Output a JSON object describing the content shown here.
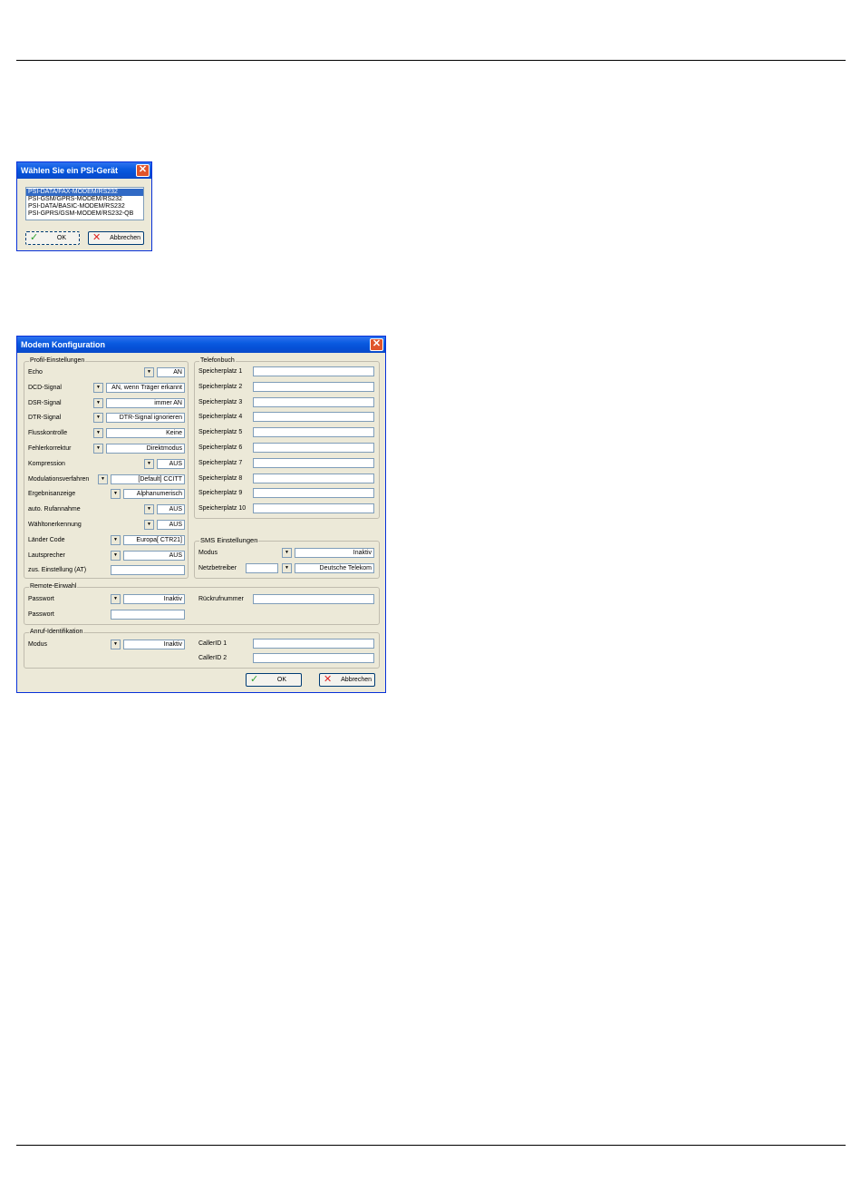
{
  "select_dialog": {
    "title": "Wählen Sie ein PSI-Gerät",
    "devices": [
      "PSI-DATA/FAX-MODEM/RS232",
      "PSI-GSM/GPRS-MODEM/RS232",
      "PSI-DATA/BASIC-MODEM/RS232",
      "PSI-GPRS/GSM-MODEM/RS232-QB"
    ],
    "ok_label": "OK",
    "cancel_label": "Abbrechen"
  },
  "config_dialog": {
    "title": "Modem Konfiguration",
    "profil": {
      "legend": "Profil-Einstellungen",
      "fields": [
        {
          "label": "Echo",
          "value": "AN"
        },
        {
          "label": "DCD-Signal",
          "value": "AN, wenn Träger erkannt"
        },
        {
          "label": "DSR-Signal",
          "value": "immer AN"
        },
        {
          "label": "DTR-Signal",
          "value": "DTR-Signal ignorieren"
        },
        {
          "label": "Flusskontrolle",
          "value": "Keine"
        },
        {
          "label": "Fehlerkorrektur",
          "value": "Direktmodus"
        },
        {
          "label": "Kompression",
          "value": "AUS"
        },
        {
          "label": "Modulationsverfahren",
          "value": "[Default] CCITT"
        },
        {
          "label": "Ergebnisanzeige",
          "value": "Alphanumerisch"
        },
        {
          "label": "auto. Rufannahme",
          "value": "AUS"
        },
        {
          "label": "Wähltonerkennung",
          "value": "AUS"
        },
        {
          "label": "Länder Code",
          "value": "Europa[ CTR21]"
        },
        {
          "label": "Lautsprecher",
          "value": "AUS"
        },
        {
          "label": "zus. Einstellung (AT)",
          "value": ""
        }
      ]
    },
    "telefonbuch": {
      "legend": "Telefonbuch",
      "entries": [
        "Speicherplatz 1",
        "Speicherplatz 2",
        "Speicherplatz 3",
        "Speicherplatz 4",
        "Speicherplatz 5",
        "Speicherplatz 6",
        "Speicherplatz 7",
        "Speicherplatz 8",
        "Speicherplatz 9",
        "Speicherplatz 10"
      ]
    },
    "sms": {
      "legend": "SMS Einstellungen",
      "modus_label": "Modus",
      "modus_value": "Inaktiv",
      "netz_label": "Netzbetreiber",
      "netz_value": "Deutsche Telekom"
    },
    "remote": {
      "legend": "Remote-Einwahl",
      "passwort_label": "Passwort",
      "passwort_value": "Inaktiv",
      "passwort2_label": "Passwort",
      "rueckruf_label": "Rückrufnummer"
    },
    "anruf": {
      "legend": "Anruf-Identifikation",
      "modus_label": "Modus",
      "modus_value": "Inaktiv",
      "caller1_label": "CallerID 1",
      "caller2_label": "CallerID 2"
    },
    "ok_label": "OK",
    "cancel_label": "Abbrechen"
  }
}
